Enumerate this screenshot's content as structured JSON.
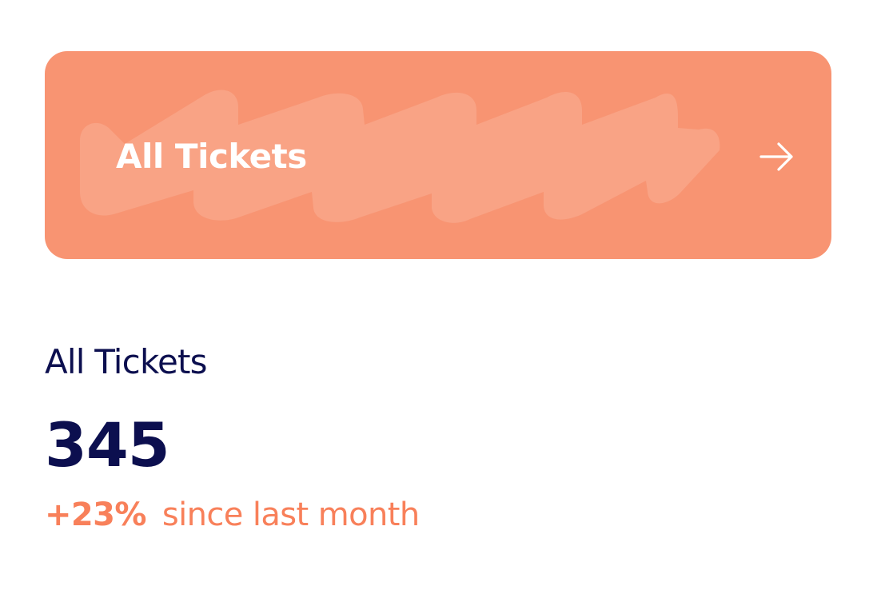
{
  "card": {
    "title": "All Tickets",
    "action_icon": "arrow-right-icon",
    "background_color": "#f89472"
  },
  "stat": {
    "label": "All Tickets",
    "value": "345",
    "change_percent": "+23%",
    "change_text": "since last month"
  },
  "colors": {
    "primary_text": "#0c0f4f",
    "accent": "#f8805a"
  }
}
